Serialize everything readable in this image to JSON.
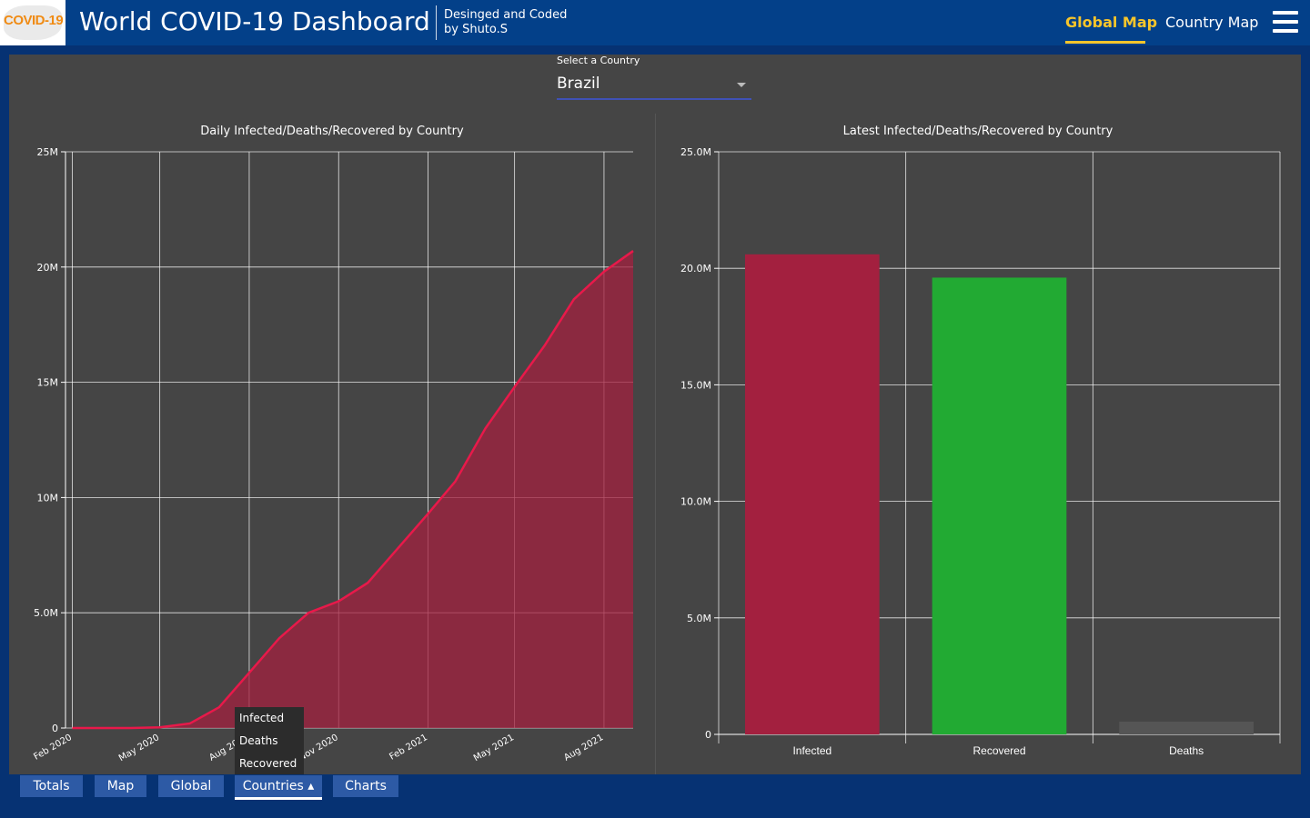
{
  "header": {
    "logo_text": "COVID-19",
    "title": "World COVID-19 Dashboard",
    "credit_line1": "Desinged and Coded",
    "credit_line2": "by Shuto.S",
    "nav": {
      "global_map": "Global Map",
      "country_map": "Country Map"
    },
    "accent_color": "#f7c52b"
  },
  "country_select": {
    "label": "Select a Country",
    "value": "Brazil"
  },
  "dropdown_menu": {
    "items": [
      "Infected",
      "Deaths",
      "Recovered"
    ]
  },
  "bottom_tabs": [
    {
      "label": "Totals"
    },
    {
      "label": "Map"
    },
    {
      "label": "Global"
    },
    {
      "label": "Countries ▴",
      "active": true
    },
    {
      "label": "Charts"
    }
  ],
  "chart_data": [
    {
      "type": "area",
      "title": "Daily Infected/Deaths/Recovered by Country",
      "series": [
        {
          "name": "Infected",
          "color": "#e8194a",
          "x": [
            "2020-02-01",
            "2020-04-01",
            "2020-05-01",
            "2020-06-01",
            "2020-07-01",
            "2020-08-01",
            "2020-09-01",
            "2020-10-01",
            "2020-11-01",
            "2020-12-01",
            "2021-01-01",
            "2021-02-01",
            "2021-03-01",
            "2021-04-01",
            "2021-05-01",
            "2021-06-01",
            "2021-07-01",
            "2021-08-01",
            "2021-08-31"
          ],
          "values": [
            0,
            0,
            0.03,
            0.2,
            0.9,
            2.4,
            3.9,
            5.0,
            5.5,
            6.3,
            7.8,
            9.3,
            10.7,
            13.0,
            14.8,
            16.6,
            18.6,
            19.8,
            20.7
          ]
        }
      ],
      "x_tick_labels": [
        "Feb 2020",
        "May 2020",
        "Aug 2020",
        "Nov 2020",
        "Feb 2021",
        "May 2021",
        "Aug 2021"
      ],
      "x_tick_dates": [
        "2020-02-01",
        "2020-05-01",
        "2020-08-01",
        "2020-11-01",
        "2021-02-01",
        "2021-05-01",
        "2021-08-01"
      ],
      "y_tick_labels": [
        "0",
        "5.0M",
        "10M",
        "15M",
        "20M",
        "25M"
      ],
      "ylim": [
        0,
        25
      ],
      "y_unit": "M",
      "grid": true
    },
    {
      "type": "bar",
      "title": "Latest Infected/Deaths/Recovered by Country",
      "categories": [
        "Infected",
        "Recovered",
        "Deaths"
      ],
      "values": [
        20.6,
        19.6,
        0.55
      ],
      "colors": [
        "#a3203f",
        "#22aa33",
        "#555555"
      ],
      "y_tick_labels": [
        "0",
        "5.0M",
        "10.0M",
        "15.0M",
        "20.0M",
        "25.0M"
      ],
      "ylim": [
        0,
        25
      ],
      "y_unit": "M",
      "grid": true
    }
  ]
}
